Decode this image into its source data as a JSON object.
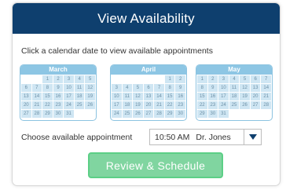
{
  "header": {
    "title": "View Availability"
  },
  "instruction": "Click a calendar date to view available appointments",
  "calendars": [
    {
      "month": "March",
      "offset": 2,
      "days": 31
    },
    {
      "month": "April",
      "offset": 5,
      "days": 30
    },
    {
      "month": "May",
      "offset": 0,
      "days": 31
    }
  ],
  "appointment": {
    "label": "Choose available appointment",
    "time": "10:50 AM",
    "doctor": "Dr. Jones"
  },
  "action": {
    "label": "Review & Schedule"
  },
  "colors": {
    "header_bg": "#0e3f6e",
    "calendar_accent": "#8dc6e4",
    "button_green": "#80d5a0"
  }
}
